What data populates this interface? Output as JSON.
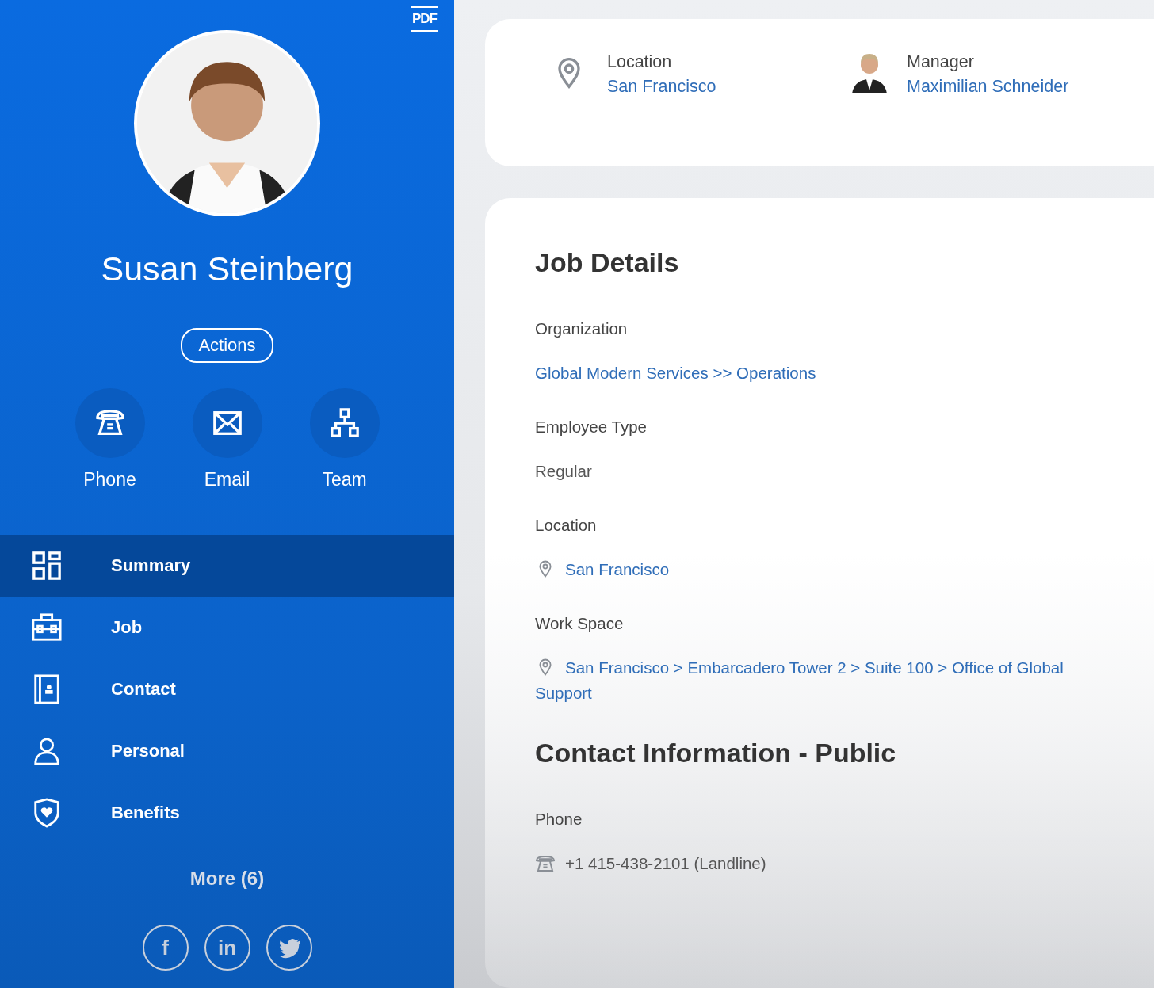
{
  "profile": {
    "pdf_label": "PDF",
    "name": "Susan Steinberg",
    "actions_label": "Actions"
  },
  "quick_actions": [
    {
      "kind": "phone",
      "label": "Phone"
    },
    {
      "kind": "email",
      "label": "Email"
    },
    {
      "kind": "team",
      "label": "Team"
    }
  ],
  "nav": [
    {
      "kind": "summary",
      "label": "Summary",
      "selected": true
    },
    {
      "kind": "job",
      "label": "Job",
      "selected": false
    },
    {
      "kind": "contact",
      "label": "Contact",
      "selected": false
    },
    {
      "kind": "personal",
      "label": "Personal",
      "selected": false
    },
    {
      "kind": "benefits",
      "label": "Benefits",
      "selected": false
    }
  ],
  "more_label": "More (6)",
  "social": [
    {
      "kind": "facebook",
      "label": "f"
    },
    {
      "kind": "linkedin",
      "label": "in"
    },
    {
      "kind": "twitter"
    }
  ],
  "summary_card": [
    {
      "kind": "location",
      "label": "Location",
      "value": "San Francisco"
    },
    {
      "kind": "person",
      "label": "Manager",
      "value": "Maximilian Schneider"
    }
  ],
  "job_details": {
    "title": "Job Details",
    "fields": [
      {
        "kind": "link",
        "label": "Organization",
        "value": "Global Modern Services >> Operations"
      },
      {
        "kind": "text",
        "label": "Employee Type",
        "value": "Regular"
      },
      {
        "kind": "place",
        "label": "Location",
        "value": "San Francisco"
      },
      {
        "kind": "place",
        "label": "Work Space",
        "value": "San Francisco > Embarcadero Tower 2 > Suite 100 > Office of Global Support"
      }
    ]
  },
  "contact": {
    "title": "Contact Information - Public",
    "fields": [
      {
        "kind": "phone",
        "label": "Phone",
        "value": "+1 415-438-2101 (Landline)"
      }
    ]
  }
}
